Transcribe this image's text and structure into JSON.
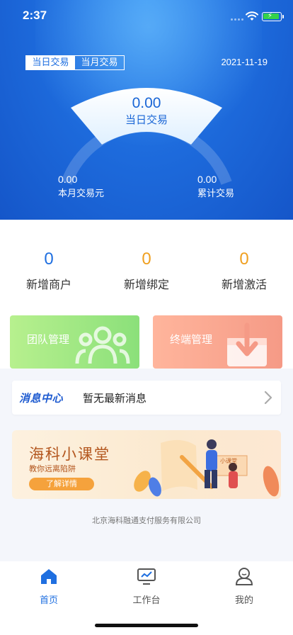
{
  "status_bar": {
    "time": "2:37"
  },
  "header": {
    "tabs": [
      {
        "label": "当日交易",
        "active": true
      },
      {
        "label": "当月交易",
        "active": false
      }
    ],
    "date": "2021-11-19"
  },
  "gauge": {
    "today_value": "0.00",
    "today_label": "当日交易",
    "left_value": "0.00",
    "left_label": "本月交易元",
    "right_value": "0.00",
    "right_label": "累计交易"
  },
  "metrics": [
    {
      "value": "0",
      "label": "新增商户",
      "color": "#1f6fe0"
    },
    {
      "value": "0",
      "label": "新增绑定",
      "color": "#f0a020"
    },
    {
      "value": "0",
      "label": "新增激活",
      "color": "#f0a020"
    }
  ],
  "cards": {
    "team": {
      "label": "团队管理",
      "icon": "group-icon"
    },
    "terminal": {
      "label": "终端管理",
      "icon": "download-box-icon"
    }
  },
  "message": {
    "logo": "消息中心",
    "text": "暂无最新消息",
    "icon": "chevron-right-icon"
  },
  "banner": {
    "title": "海科小课堂",
    "subtitle": "教你远离陷阱",
    "button": "了解详情",
    "board_text": "小课堂"
  },
  "footer": {
    "company": "北京海科融通支付服务有限公司"
  },
  "tabbar": [
    {
      "label": "首页",
      "icon": "home-icon",
      "active": true
    },
    {
      "label": "工作台",
      "icon": "monitor-icon",
      "active": false
    },
    {
      "label": "我的",
      "icon": "user-icon",
      "active": false
    }
  ],
  "colors": {
    "primary": "#1f6fe0",
    "accent": "#f0a020"
  }
}
